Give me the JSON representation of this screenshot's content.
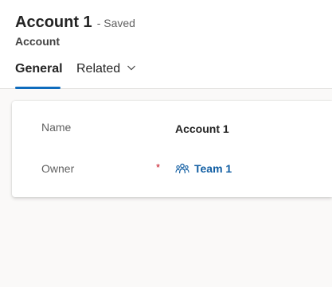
{
  "record": {
    "title": "Account 1",
    "save_status": "- Saved",
    "entity_type": "Account"
  },
  "tabs": [
    {
      "label": "General",
      "active": true
    },
    {
      "label": "Related",
      "active": false,
      "icon": "chevron-down-icon"
    }
  ],
  "form": {
    "name_label": "Name",
    "name_value": "Account 1",
    "owner_label": "Owner",
    "owner_required_mark": "*",
    "owner_value": "Team 1",
    "owner_icon": "team-icon"
  },
  "colors": {
    "accent": "#0f6cbd",
    "link": "#115ea3",
    "required": "#c50f1f"
  }
}
